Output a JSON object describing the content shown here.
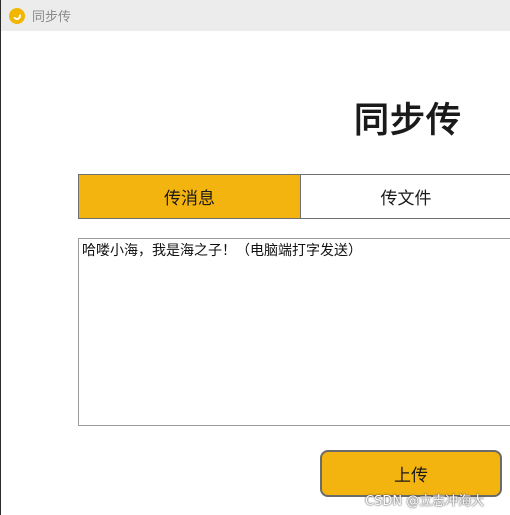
{
  "window": {
    "title": "同步传",
    "icon": "sync-app-icon"
  },
  "page": {
    "heading": "同步传"
  },
  "tabs": [
    {
      "label": "传消息",
      "active": true
    },
    {
      "label": "传文件",
      "active": false
    }
  ],
  "message": {
    "value": "哈喽小海，我是海之子！（电脑端打字发送）"
  },
  "actions": {
    "upload_label": "上传"
  },
  "watermark": {
    "text": "CSDN @立志冲海大"
  },
  "colors": {
    "accent": "#f3b40f",
    "titlebar": "#ececec"
  }
}
